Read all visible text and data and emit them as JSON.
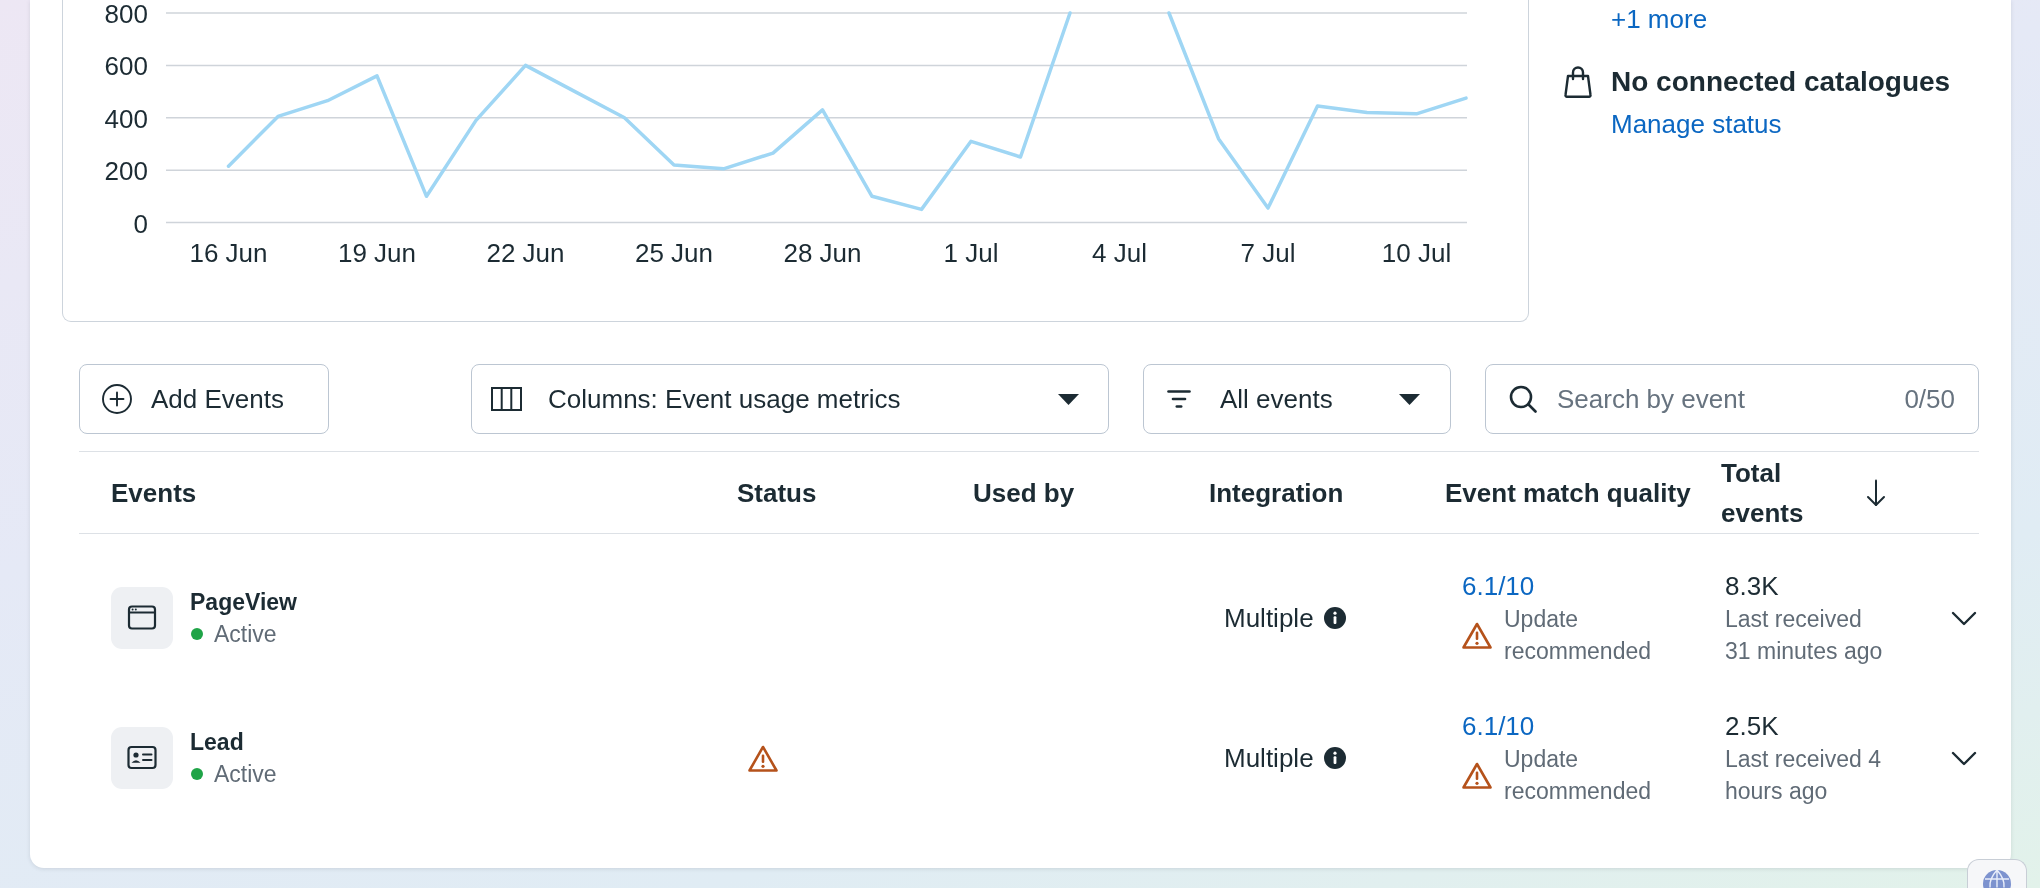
{
  "chart_panel": {
    "chart_data": {
      "type": "line",
      "categories": [
        "16 Jun",
        null,
        null,
        "19 Jun",
        null,
        null,
        "22 Jun",
        null,
        null,
        "25 Jun",
        null,
        null,
        "28 Jun",
        null,
        null,
        "1 Jul",
        null,
        null,
        "4 Jul",
        null,
        null,
        "7 Jul",
        null,
        null,
        "10 Jul",
        null
      ],
      "yticks": [
        0,
        200,
        400,
        600,
        800
      ],
      "ylim": [
        0,
        800
      ],
      "grid": true,
      "series": [
        {
          "color": "#9fd6f4",
          "values": [
            215,
            405,
            465,
            560,
            100,
            390,
            600,
            500,
            400,
            220,
            205,
            265,
            430,
            100,
            50,
            310,
            250,
            800,
            null,
            800,
            320,
            55,
            445,
            420,
            415,
            475
          ]
        }
      ]
    }
  },
  "side_panel": {
    "more_link": "+1 more",
    "catalogues": {
      "title": "No connected catalogues",
      "link": "Manage status"
    }
  },
  "toolbar": {
    "add_button": "Add Events",
    "columns_dropdown": "Columns: Event usage metrics",
    "filter_dropdown": "All events",
    "search": {
      "placeholder": "Search by event",
      "counter": "0/50"
    }
  },
  "table": {
    "columns": [
      {
        "label": "Events",
        "sorted": false
      },
      {
        "label": "Status",
        "sorted": false
      },
      {
        "label": "Used by",
        "sorted": false
      },
      {
        "label": "Integration",
        "sorted": false
      },
      {
        "label": "Event match quality",
        "sorted": false
      },
      {
        "label": "Total events",
        "sorted": true
      }
    ],
    "rows": [
      {
        "kind": "window",
        "name": "PageView",
        "status": {
          "label": "Active",
          "color": "#1fa447"
        },
        "alert": false,
        "integration": "Multiple",
        "match_quality": "6.1/10",
        "match_note": "Update recommended",
        "total": "8.3K",
        "last_received": "Last received 31 minutes ago",
        "expanded": false
      },
      {
        "kind": "card",
        "name": "Lead",
        "status": {
          "label": "Active",
          "color": "#1fa447"
        },
        "alert": true,
        "integration": "Multiple",
        "match_quality": "6.1/10",
        "match_note": "Update recommended",
        "total": "2.5K",
        "last_received": "Last received 4 hours ago",
        "expanded": false
      }
    ]
  }
}
